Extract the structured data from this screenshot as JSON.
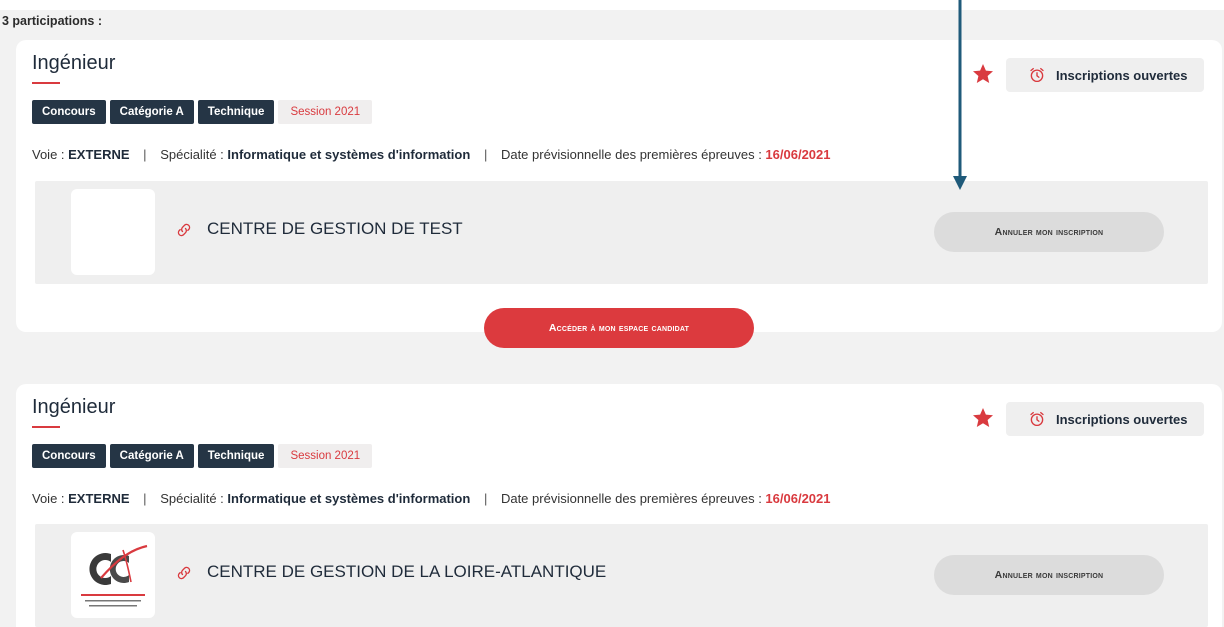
{
  "header": {
    "count_label": "3 participations :"
  },
  "cards": [
    {
      "title": "Ingénieur",
      "tags": [
        "Concours",
        "Catégorie A",
        "Technique"
      ],
      "session": "Session 2021",
      "meta": {
        "voie_label": "Voie : ",
        "voie_value": "EXTERNE",
        "specialite_label": "Spécialité : ",
        "specialite_value": "Informatique et systèmes d'information",
        "date_label": "Date prévisionnelle des premières épreuves : ",
        "date_value": "16/06/2021",
        "separator": "|"
      },
      "status": "Inscriptions ouvertes",
      "organization": "CENTRE DE GESTION DE TEST",
      "cancel_label": "Annuler mon inscription",
      "access_label": "Accéder à mon espace candidat"
    },
    {
      "title": "Ingénieur",
      "tags": [
        "Concours",
        "Catégorie A",
        "Technique"
      ],
      "session": "Session 2021",
      "meta": {
        "voie_label": "Voie : ",
        "voie_value": "EXTERNE",
        "specialite_label": "Spécialité : ",
        "specialite_value": "Informatique et systèmes d'information",
        "date_label": "Date prévisionnelle des premières épreuves : ",
        "date_value": "16/06/2021",
        "separator": "|"
      },
      "status": "Inscriptions ouvertes",
      "organization": "CENTRE DE GESTION DE LA LOIRE-ATLANTIQUE",
      "logo_text": "CENTRE de GESTION LOIRE-ATLANTIQUE",
      "cancel_label": "Annuler mon inscription"
    }
  ],
  "colors": {
    "accent_red": "#dc3a3e",
    "navy": "#253545",
    "annotation_arrow": "#1f5a7a"
  },
  "icons": {
    "favorite": "star-icon",
    "status": "alarm-clock-icon",
    "link": "link-icon"
  }
}
